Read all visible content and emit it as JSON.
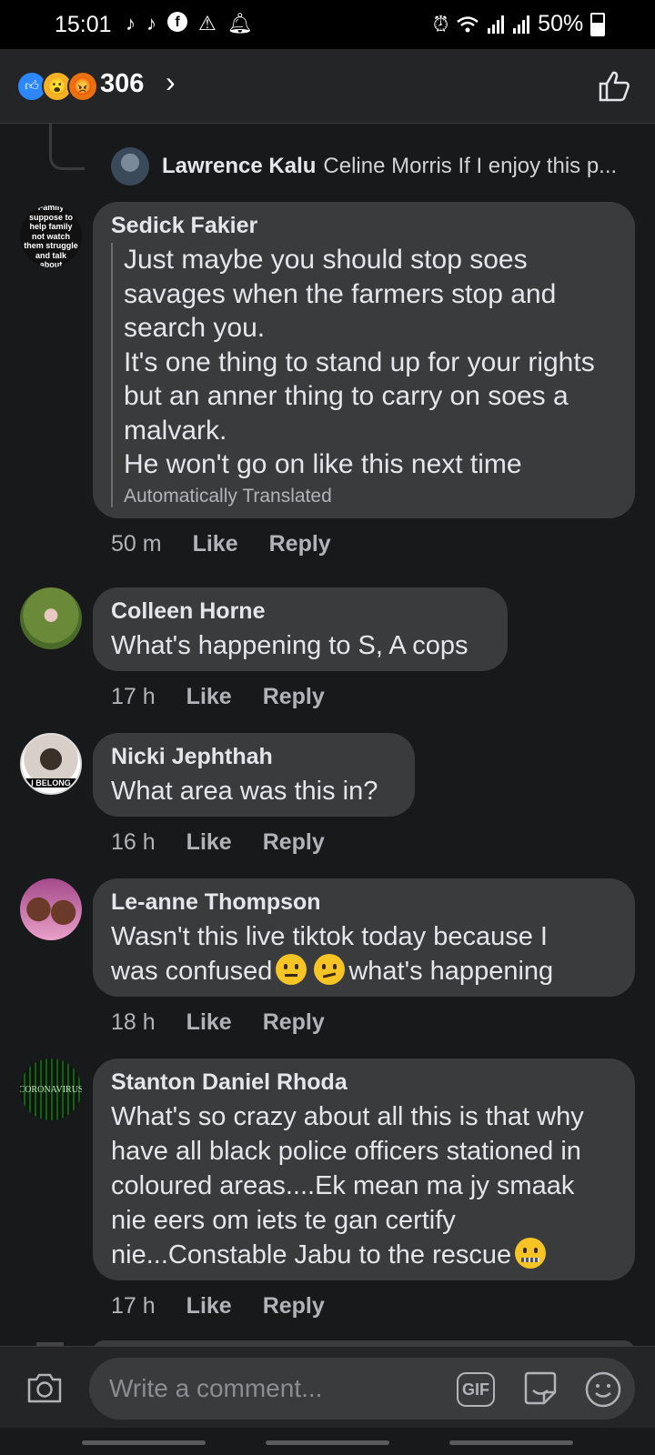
{
  "status_bar": {
    "time": "15:01",
    "battery": "50%",
    "left_icons": [
      "tiktok-icon",
      "tiktok-icon",
      "facebook-icon",
      "notification-icon",
      "bell-icon"
    ],
    "right_icons": [
      "alarm-icon",
      "wifi-icon",
      "signal-icon",
      "signal-icon",
      "battery-icon"
    ]
  },
  "reactions": {
    "count": "306",
    "types": [
      "like",
      "wow",
      "angry"
    ],
    "chevron": "›"
  },
  "reply_preview": {
    "name": "Lawrence Kalu",
    "text": "Celine Morris If I enjoy this p..."
  },
  "comments": [
    {
      "author": "Sedick Fakier",
      "avatar_text": "Family suppose to help family not watch them struggle and talk about",
      "body_lines": [
        "Just maybe you should stop soes",
        "savages when the farmers stop and",
        "search you.",
        "It's one thing to stand up for your rights",
        "but an anner thing to carry on soes a",
        "malvark.",
        "He won't go on like this next time"
      ],
      "translation_note": "Automatically Translated",
      "time": "50 m",
      "like": "Like",
      "reply": "Reply"
    },
    {
      "author": "Colleen Horne",
      "body": "What's happening to S, A cops",
      "time": "17 h",
      "like": "Like",
      "reply": "Reply"
    },
    {
      "author": "Nicki Jephthah",
      "avatar_text": "I BELONG",
      "body": "What area was this in?",
      "time": "16 h",
      "like": "Like",
      "reply": "Reply"
    },
    {
      "author": "Le-anne Thompson",
      "body_line1": "Wasn't this live tiktok today because I",
      "body_line2_a": "was confused",
      "body_line2_b": "what's happening",
      "time": "18 h",
      "like": "Like",
      "reply": "Reply"
    },
    {
      "author": "Stanton Daniel Rhoda",
      "avatar_text": "CORONAVIRUS",
      "body_lines": [
        "What's so crazy about all this is that why",
        "have all black police officers stationed in",
        "coloured areas....Ek mean ma jy smaak",
        "nie eers om iets te gan certify"
      ],
      "body_last": "nie...Constable Jabu to the rescue",
      "time": "17 h",
      "like": "Like",
      "reply": "Reply"
    }
  ],
  "compose": {
    "placeholder": "Write a comment...",
    "gif_label": "GIF"
  }
}
